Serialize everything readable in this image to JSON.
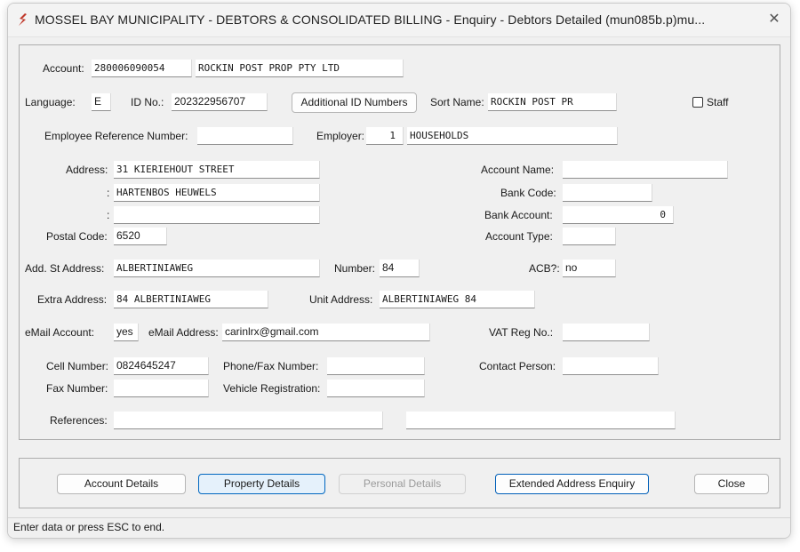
{
  "window": {
    "title": "MOSSEL BAY MUNICIPALITY - DEBTORS & CONSOLIDATED BILLING - Enquiry - Debtors Detailed (mun085b.p)mu...",
    "close_glyph": "✕"
  },
  "colors": {
    "app_icon": "#c0392b",
    "focus_border": "#0067c0"
  },
  "form": {
    "account_label": "Account:",
    "account_number": "280006090054",
    "account_holder": "ROCKIN POST PROP PTY LTD",
    "language_label": "Language:",
    "language": "E",
    "id_no_label": "ID No.:",
    "id_no": "202322956707",
    "additional_id_button": "Additional ID Numbers",
    "sort_name_label": "Sort Name:",
    "sort_name": "ROCKIN POST PR",
    "staff_label": "Staff",
    "staff_checked": false,
    "employee_ref_label": "Employee Reference Number:",
    "employee_ref": "",
    "employer_label": "Employer:",
    "employer_code": "1",
    "employer_name": "HOUSEHOLDS",
    "address_label": "Address:",
    "address_line1": "31 KIERIEHOUT STREET",
    "address_cont_label": ":",
    "address_line2": "HARTENBOS HEUWELS",
    "address_line3": "",
    "postal_code_label": "Postal Code:",
    "postal_code": "6520",
    "account_name_label": "Account Name:",
    "account_name": "",
    "bank_code_label": "Bank Code:",
    "bank_code": "",
    "bank_account_label": "Bank Account:",
    "bank_account": "0",
    "account_type_label": "Account Type:",
    "account_type": "",
    "add_st_address_label": "Add. St Address:",
    "add_st_address": "ALBERTINIAWEG",
    "number_label": "Number:",
    "number": "84",
    "acb_label": "ACB?:",
    "acb": "no",
    "extra_address_label": "Extra Address:",
    "extra_address": "84 ALBERTINIAWEG",
    "unit_address_label": "Unit Address:",
    "unit_address": "ALBERTINIAWEG 84",
    "email_account_label": "eMail Account:",
    "email_account": "yes",
    "email_address_label": "eMail Address:",
    "email_address": "carinlrx@gmail.com",
    "vat_reg_label": "VAT Reg No.:",
    "vat_reg": "",
    "cell_number_label": "Cell Number:",
    "cell_number": "0824645247",
    "phone_fax_label": "Phone/Fax Number:",
    "phone_fax": "",
    "contact_person_label": "Contact Person:",
    "contact_person": "",
    "fax_number_label": "Fax Number:",
    "fax_number": "",
    "vehicle_reg_label": "Vehicle Registration:",
    "vehicle_reg": "",
    "references_label": "References:",
    "references1": "",
    "references2": ""
  },
  "buttons": {
    "account_details": "Account Details",
    "property_details": "Property Details",
    "personal_details": "Personal Details",
    "extended_address": "Extended Address Enquiry",
    "close": "Close"
  },
  "status": {
    "text": "Enter data or press ESC to end."
  }
}
